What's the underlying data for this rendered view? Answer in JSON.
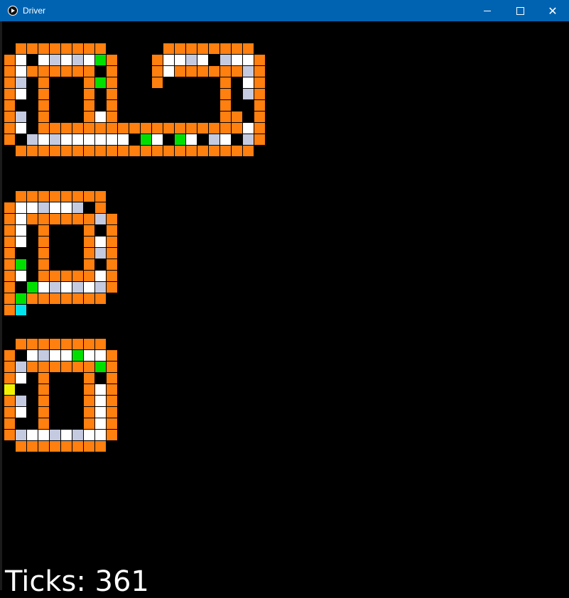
{
  "window": {
    "title": "Driver",
    "icon": "play-circle-icon",
    "controls": {
      "minimize": "minimize-icon",
      "maximize": "maximize-icon",
      "close": "close-icon",
      "close_glyph": "✕"
    }
  },
  "status": {
    "ticks_text": "Ticks: 361"
  },
  "colors": {
    "O": "#FF7F0F",
    "W": "#FFFFFF",
    "L": "#C4CAE0",
    "G": "#00E000",
    "C": "#00E5EE",
    "Y": "#F2F200",
    ".": "#000000"
  },
  "grid": {
    "rows": [
      ".OOOOOOOO.....OOOOOOOO",
      "OW.WLWLWGO...OWWLW.LWWO",
      "OWOOOOOO.O...OWOOOOOOLO",
      "OL.O...OGO...O.....O.WO",
      "OW.O...O.O.........O.LO",
      "O..O...O.O.........O..O",
      "OL.O...OWO.........OO.O",
      "OW.OOOOOOOOOOOOOOOOOOWO",
      "O.LWLWWWWWW.GW.GW.LW.LO",
      ".OOOOOOOOOOOOOOOOOOOOO",
      "",
      "",
      "",
      ".OOOOOOOO",
      "OWWLWWL.O",
      "OWOOOOOOLO",
      "OW.O...O.O",
      "OW.O...OWO",
      "O..O...OLO",
      "OG.O...O.O",
      "OW.OOOOOWO",
      "O.GWLWLWLO",
      "OGOOOOOOO",
      "OC.",
      "",
      "",
      ".OOOOOOOO",
      "O.WLWWGWWO",
      "OLOOOOOOGO",
      "OW.O...O.O",
      "Y..O...OWO",
      "OL.O...OWO",
      "OW.O...OWO",
      "O..O...OWO",
      "OLWWLWLWWO",
      ".OOOOOOOO"
    ]
  }
}
